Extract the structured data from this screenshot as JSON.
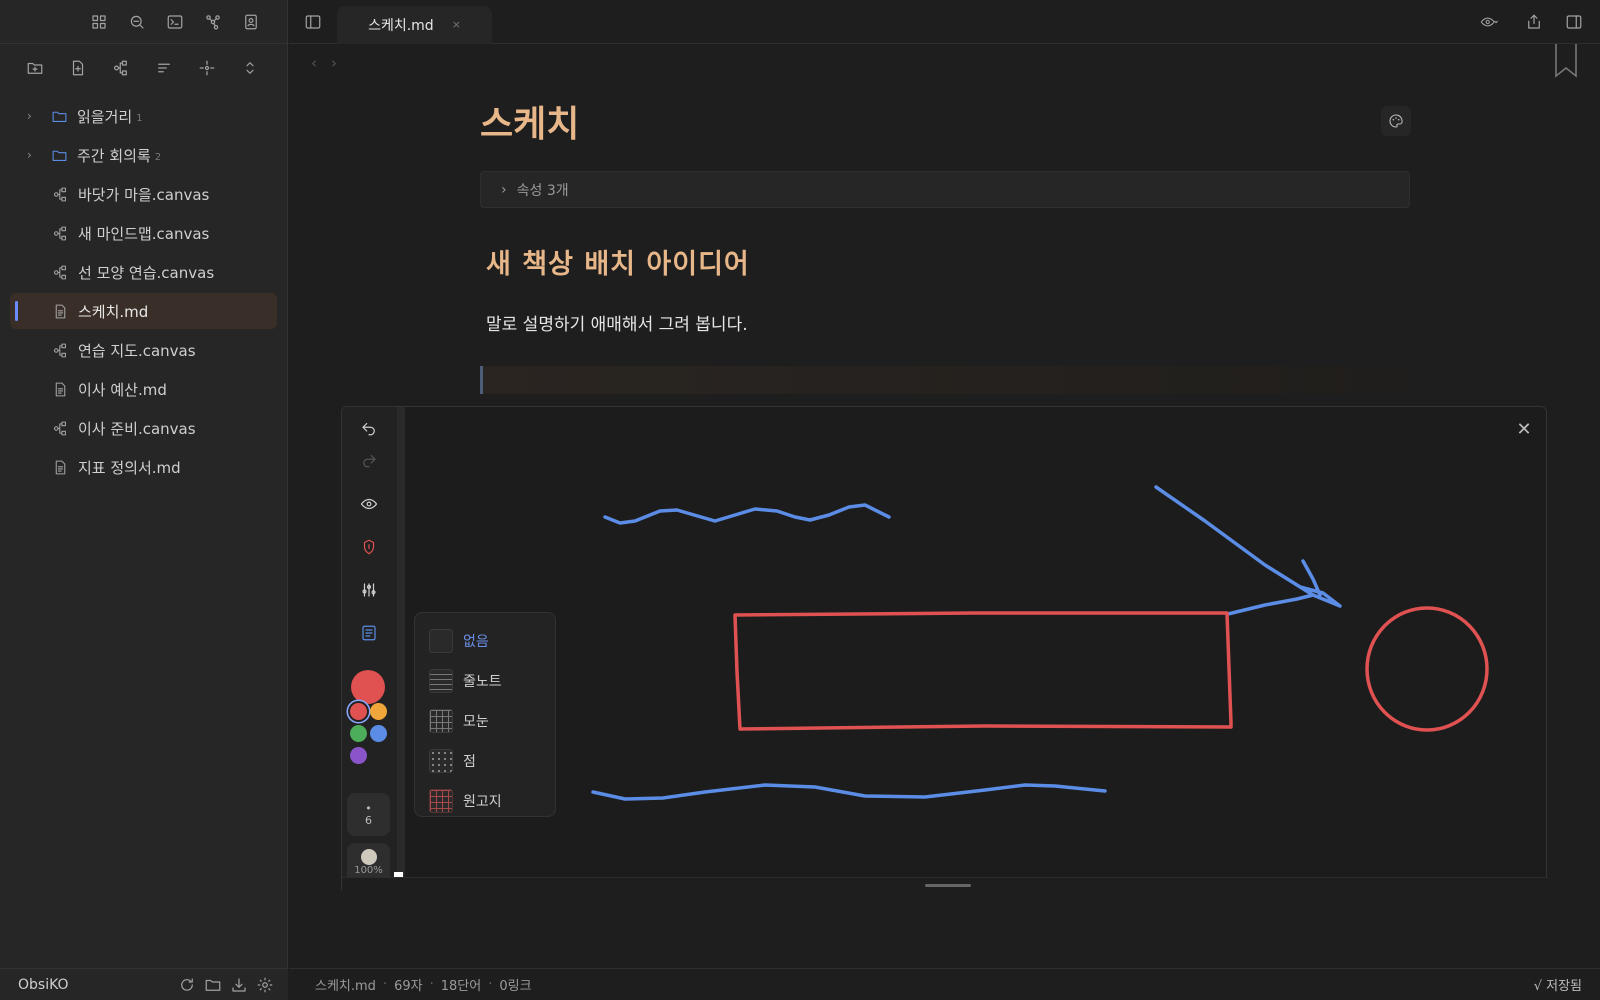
{
  "sidebar": {
    "ribbon_icons": [
      "grid-icon",
      "search-icon",
      "terminal-icon",
      "graph-icon",
      "contact-icon"
    ],
    "nav_actions": [
      "new-folder-icon",
      "new-note-icon",
      "new-canvas-icon",
      "sort-icon",
      "reveal-icon",
      "collapse-icon"
    ],
    "items": [
      {
        "type": "folder",
        "label": "읽을거리",
        "count": "1"
      },
      {
        "type": "folder",
        "label": "주간 회의록",
        "count": "2"
      },
      {
        "type": "canvas",
        "label": "바닷가 마을.canvas"
      },
      {
        "type": "canvas",
        "label": "새 마인드맵.canvas"
      },
      {
        "type": "canvas",
        "label": "선 모양 연습.canvas"
      },
      {
        "type": "md",
        "label": "스케치.md",
        "active": true
      },
      {
        "type": "canvas",
        "label": "연습 지도.canvas"
      },
      {
        "type": "md",
        "label": "이사 예산.md"
      },
      {
        "type": "canvas",
        "label": "이사 준비.canvas"
      },
      {
        "type": "md",
        "label": "지표 정의서.md"
      }
    ],
    "vault_name": "ObsiKO"
  },
  "tab": {
    "label": "스케치.md",
    "close": "×"
  },
  "note": {
    "title": "스케치",
    "properties": "속성 3개",
    "heading": "새 책상 배치 아이디어",
    "paragraph": "말로 설명하기 애매해서 그려 봅니다."
  },
  "drawing": {
    "brush_size": "6",
    "opacity": "100%",
    "colors": {
      "current": "#e05252",
      "swatches": [
        "#e05252",
        "#f0a63a",
        "#4cae5a",
        "#5b8de6",
        "#8b55c9"
      ]
    },
    "background_menu": [
      {
        "label": "없음",
        "selected": true
      },
      {
        "label": "줄노트"
      },
      {
        "label": "모눈"
      },
      {
        "label": "점"
      },
      {
        "label": "원고지"
      }
    ]
  },
  "status": {
    "file": "스케치.md",
    "chars": "69자",
    "words": "18단어",
    "links": "0링크",
    "saved": "√ 저장됨"
  },
  "theme": {
    "accent": "#e7b78a",
    "link": "#6b8ee8",
    "stroke_red": "#e05252",
    "stroke_blue": "#5b8de6"
  }
}
